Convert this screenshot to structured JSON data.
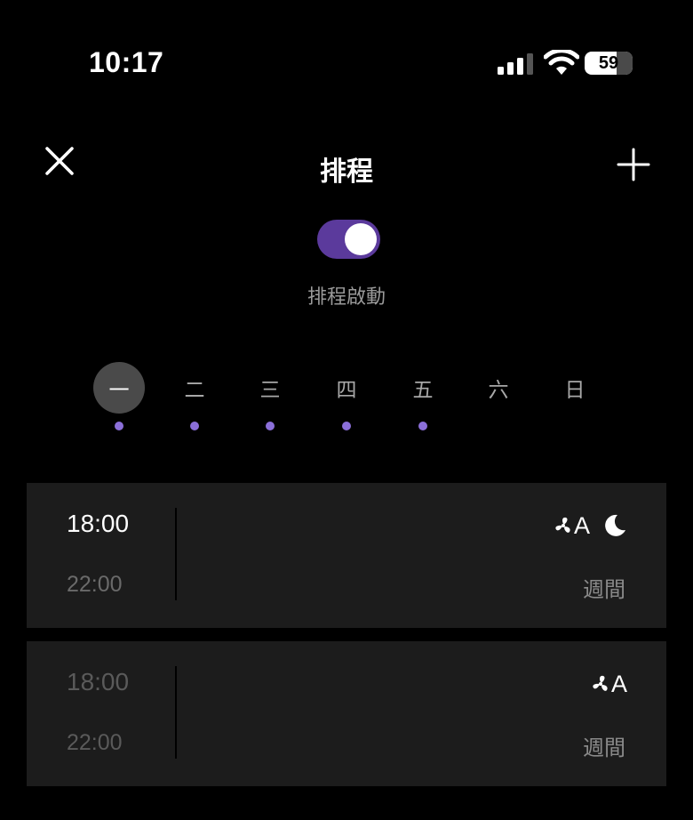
{
  "status_bar": {
    "time": "10:17",
    "battery": "59"
  },
  "header": {
    "title": "排程",
    "close_icon": "close-icon",
    "add_icon": "plus-icon"
  },
  "toggle": {
    "on": true,
    "label": "排程啟動",
    "on_color": "#5b3a9c"
  },
  "days": [
    {
      "label": "一",
      "selected": true,
      "has_schedule": true
    },
    {
      "label": "二",
      "selected": false,
      "has_schedule": true
    },
    {
      "label": "三",
      "selected": false,
      "has_schedule": true
    },
    {
      "label": "四",
      "selected": false,
      "has_schedule": true
    },
    {
      "label": "五",
      "selected": false,
      "has_schedule": true
    },
    {
      "label": "六",
      "selected": false,
      "has_schedule": false
    },
    {
      "label": "日",
      "selected": false,
      "has_schedule": false
    }
  ],
  "schedules": [
    {
      "start": "18:00",
      "end": "22:00",
      "mode_letter": "A",
      "icons": [
        "fan-icon",
        "moon-icon"
      ],
      "repeat": "週間",
      "enabled": true
    },
    {
      "start": "18:00",
      "end": "22:00",
      "mode_letter": "A",
      "icons": [
        "fan-icon"
      ],
      "repeat": "週間",
      "enabled": false
    }
  ],
  "colors": {
    "background": "#000000",
    "card": "#1c1c1c",
    "accent_dot": "#8b6fd9"
  }
}
